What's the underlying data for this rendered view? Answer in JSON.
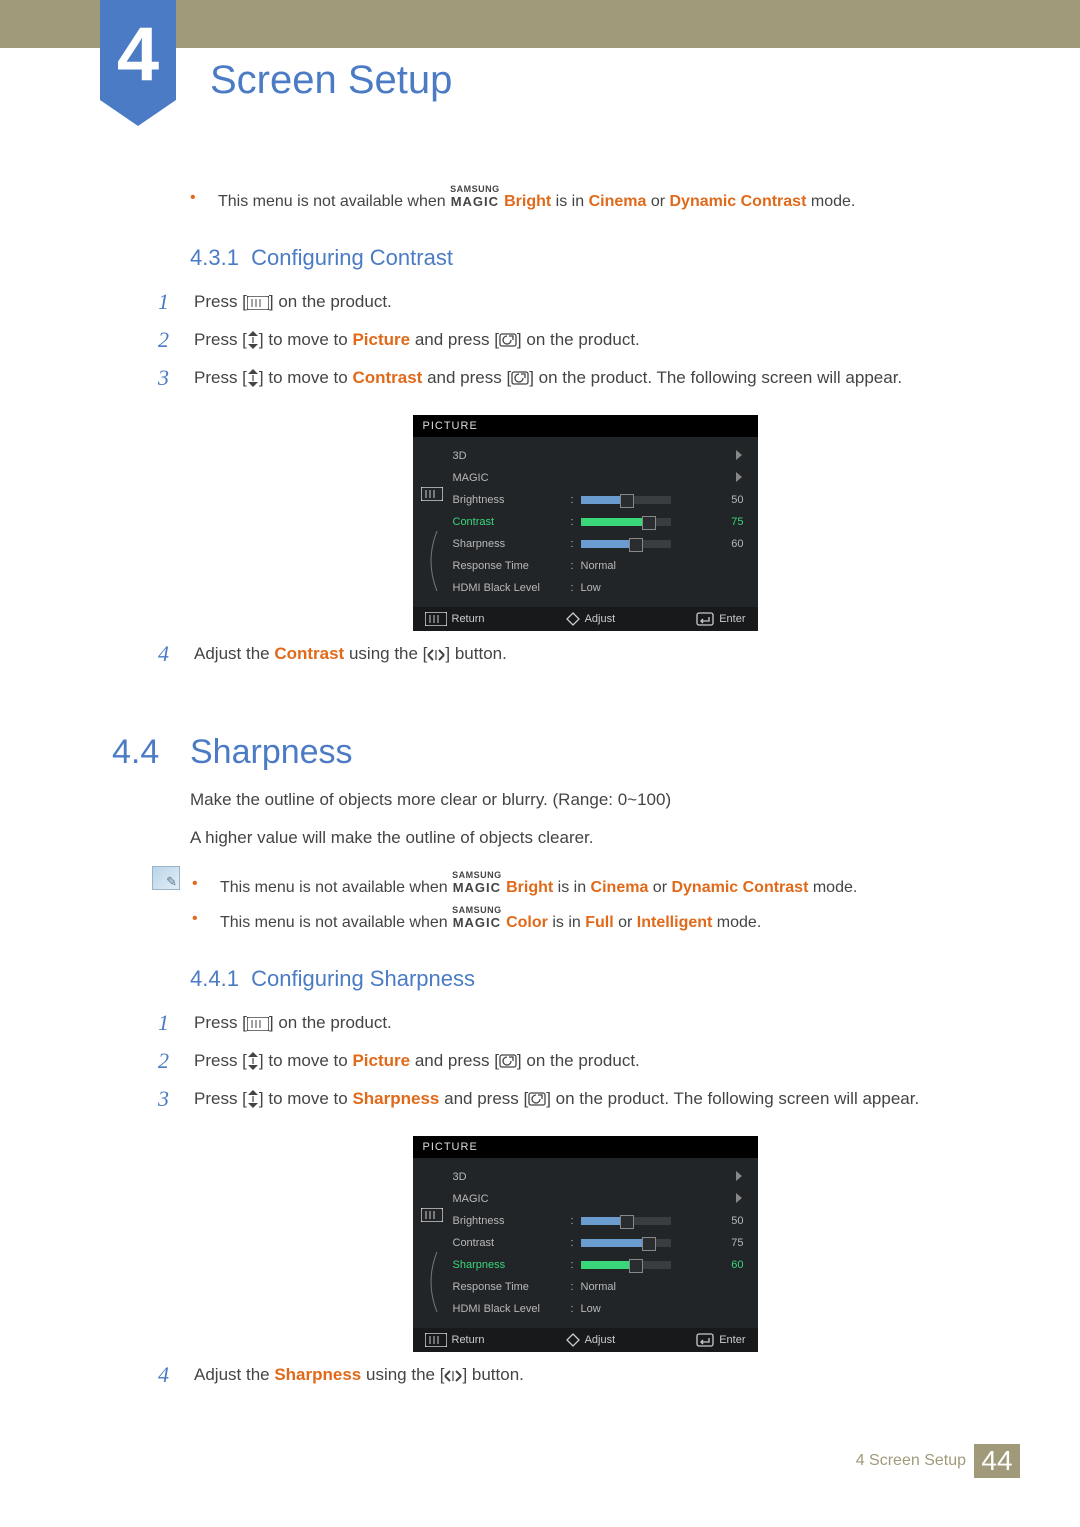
{
  "chapter": {
    "number": "4",
    "title": "Screen Setup"
  },
  "top_note": {
    "pre": "This menu is not available when ",
    "logo_top": "SAMSUNG",
    "logo_bot": "MAGIC",
    "term1": "Bright",
    "mid1": " is in ",
    "term2": "Cinema",
    "mid2": " or ",
    "term3": "Dynamic Contrast",
    "post": " mode."
  },
  "sec431": {
    "num": "4.3.1",
    "title": "Configuring Contrast"
  },
  "steps_contrast": [
    {
      "n": "1",
      "a": "Press [",
      "b": "] on the product."
    },
    {
      "n": "2",
      "a": "Press [",
      "b": "] to move to ",
      "kw": "Picture",
      "c": " and press [",
      "d": "] on the product."
    },
    {
      "n": "3",
      "a": "Press [",
      "b": "] to move to ",
      "kw": "Contrast",
      "c": " and press [",
      "d": "] on the product. The following screen will appear."
    },
    {
      "n": "4",
      "a": "Adjust the ",
      "kw": "Contrast",
      "b": " using the [",
      "c": "] button."
    }
  ],
  "sec44": {
    "num": "4.4",
    "title": "Sharpness",
    "p1": "Make the outline of objects more clear or blurry. (Range: 0~100)",
    "p2": "A higher value will make the outline of objects clearer."
  },
  "sharpness_notes": [
    {
      "pre": "This menu is not available when ",
      "term1": "Bright",
      "mid1": " is in ",
      "term2": "Cinema",
      "mid2": " or ",
      "term3": "Dynamic Contrast",
      "post": " mode."
    },
    {
      "pre": "This menu is not available when ",
      "term1": "Color",
      "mid1": " is in ",
      "term2": "Full",
      "mid2": " or ",
      "term3": "Intelligent",
      "post": " mode."
    }
  ],
  "sec441": {
    "num": "4.4.1",
    "title": "Configuring Sharpness"
  },
  "steps_sharp": [
    {
      "n": "1",
      "a": "Press [",
      "b": "] on the product."
    },
    {
      "n": "2",
      "a": "Press [",
      "b": "] to move to ",
      "kw": "Picture",
      "c": " and press [",
      "d": "] on the product."
    },
    {
      "n": "3",
      "a": "Press [",
      "b": "] to move to ",
      "kw": "Sharpness",
      "c": " and press [",
      "d": "] on the product. The following screen will appear."
    },
    {
      "n": "4",
      "a": "Adjust the ",
      "kw": "Sharpness",
      "b": " using the [",
      "c": "] button."
    }
  ],
  "osd": {
    "title": "PICTURE",
    "rows": {
      "r0": {
        "label": "3D"
      },
      "r1": {
        "label": "MAGIC"
      },
      "r2": {
        "label": "Brightness",
        "val": "50",
        "pct": 50
      },
      "r3": {
        "label": "Contrast",
        "val": "75",
        "pct": 75
      },
      "r4": {
        "label": "Sharpness",
        "val": "60",
        "pct": 60
      },
      "r5": {
        "label": "Response Time",
        "text": "Normal"
      },
      "r6": {
        "label": "HDMI Black Level",
        "text": "Low"
      }
    },
    "foot": {
      "return": "Return",
      "adjust": "Adjust",
      "enter": "Enter"
    }
  },
  "footer": {
    "text": "4 Screen Setup",
    "page": "44"
  }
}
